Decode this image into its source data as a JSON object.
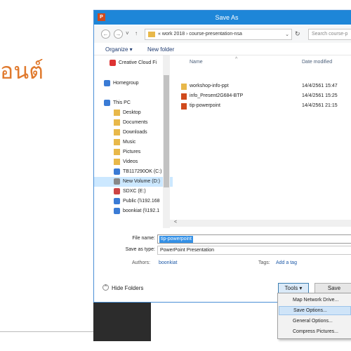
{
  "background": {
    "title": "อนต์"
  },
  "window": {
    "title": "Save As",
    "app_icon": "P"
  },
  "address": {
    "back_icon": "←",
    "forward_icon": "→",
    "down_icon": "˅",
    "up_icon": "↑",
    "path": "« work 2018 › course-presentation-nsa",
    "dropdown_icon": "⌄",
    "refresh_icon": "↻",
    "search_placeholder": "Search course-p"
  },
  "toolbar": {
    "organize": "Organize ▾",
    "new_folder": "New folder"
  },
  "nav": [
    {
      "label": "Creative Cloud Fi",
      "icon": "creative-cloud-icon",
      "color": "#d33"
    },
    {
      "label": "Homegroup",
      "icon": "homegroup-icon",
      "color": "#3a7bd5"
    },
    {
      "label": "This PC",
      "icon": "computer-icon",
      "color": "#3a7bd5"
    },
    {
      "label": "Desktop",
      "icon": "folder-icon",
      "color": "#e8b84a"
    },
    {
      "label": "Documents",
      "icon": "folder-icon",
      "color": "#e8b84a"
    },
    {
      "label": "Downloads",
      "icon": "folder-icon",
      "color": "#e8b84a"
    },
    {
      "label": "Music",
      "icon": "folder-icon",
      "color": "#e8b84a"
    },
    {
      "label": "Pictures",
      "icon": "folder-icon",
      "color": "#e8b84a"
    },
    {
      "label": "Videos",
      "icon": "folder-icon",
      "color": "#e8b84a"
    },
    {
      "label": "TB117290OK (C:)",
      "icon": "drive-icon",
      "color": "#3a7bd5"
    },
    {
      "label": "New Volume (D:)",
      "icon": "drive-icon",
      "color": "#888"
    },
    {
      "label": "SDXC (E:)",
      "icon": "sd-card-icon",
      "color": "#c44"
    },
    {
      "label": "Public (\\\\192.168",
      "icon": "network-drive-icon",
      "color": "#3a7bd5"
    },
    {
      "label": "boonkiat (\\\\192.1",
      "icon": "network-drive-icon",
      "color": "#3a7bd5"
    }
  ],
  "files": {
    "col_name": "Name",
    "col_date": "Date modified",
    "sort_icon": "^",
    "rows": [
      {
        "name": "workshop-info-ppt",
        "date": "14/4/2561 15:47",
        "icon": "folder-icon",
        "color": "#e8b84a"
      },
      {
        "name": "info_Present2G684-BTP",
        "date": "14/4/2561 15:25",
        "icon": "pptx-file-icon",
        "color": "#d04a1c"
      },
      {
        "name": "tip-powerpoint",
        "date": "14/4/2561 21:15",
        "icon": "pptx-file-icon",
        "color": "#d04a1c"
      }
    ]
  },
  "hscroll_left": "<",
  "form": {
    "filename_label": "File name:",
    "filename_value": "tip-powerpoint",
    "savetype_label": "Save as type:",
    "savetype_value": "PowerPoint Presentation",
    "authors_label": "Authors:",
    "authors_value": "boonkiat",
    "tags_label": "Tags:",
    "tags_value": "Add a tag"
  },
  "footer": {
    "hide_folders_icon": "^",
    "hide_folders": "Hide Folders",
    "tools": "Tools ▾",
    "save": "Save"
  },
  "menu": [
    {
      "label": "Map Network Drive..."
    },
    {
      "label": "Save Options..."
    },
    {
      "label": "General Options..."
    },
    {
      "label": "Compress Pictures..."
    }
  ]
}
